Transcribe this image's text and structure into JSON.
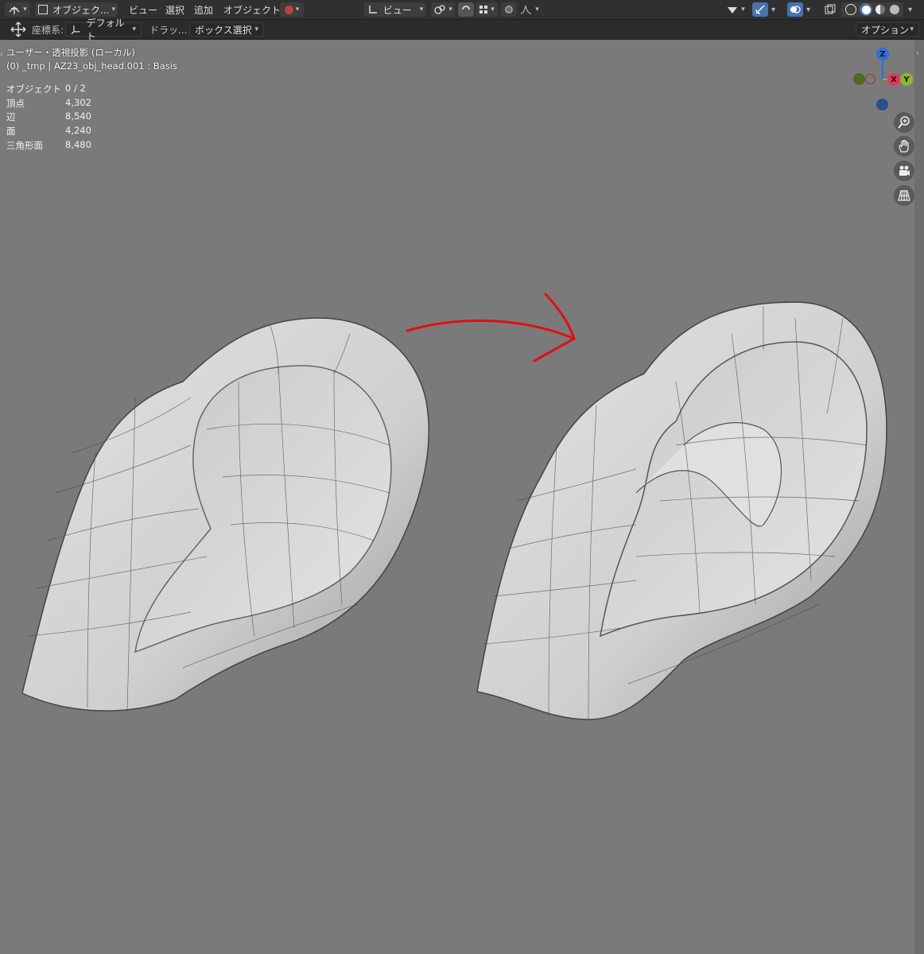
{
  "header": {
    "mode_label": "オブジェク...",
    "menu": [
      "ビュー",
      "選択",
      "追加",
      "オブジェクト"
    ],
    "transform_orientation": "ビュー"
  },
  "toolbar": {
    "coord_label": "座標系:",
    "coord_value": "デフォルト",
    "drag_label": "ドラッ...",
    "drag_value": "ボックス選択",
    "options_label": "オプション"
  },
  "viewport": {
    "view_name": "ユーザー・透視投影 (ローカル)",
    "object_name": "(0) _tmp | AZ23_obj_head.001 : Basis",
    "stats": [
      {
        "label": "オブジェクト",
        "value": "0 / 2"
      },
      {
        "label": "頂点",
        "value": "4,302"
      },
      {
        "label": "辺",
        "value": "8,540"
      },
      {
        "label": "面",
        "value": "4,240"
      },
      {
        "label": "三角形面",
        "value": "8,480"
      }
    ]
  },
  "gizmo": {
    "z": "Z",
    "x": "X",
    "y": "Y"
  },
  "colors": {
    "header": "#303030",
    "viewport": "#7a7a7a",
    "arrow": "#e01010",
    "x_axis": "#e8355a",
    "y_axis": "#8ab82e",
    "z_axis": "#2f6fd8"
  }
}
